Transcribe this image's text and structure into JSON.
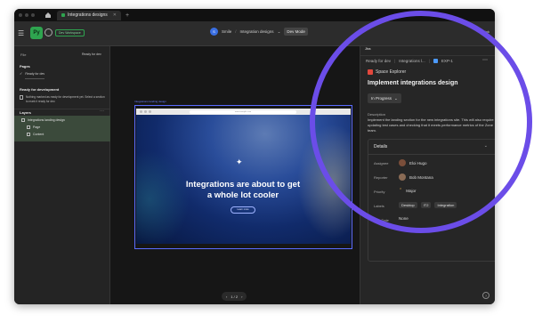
{
  "tabbar": {
    "tab_title": "Integrations designs"
  },
  "toolbar": {
    "mode_label": "Py",
    "badge": "Dev Workspace",
    "team": "Smile",
    "file": "Integration designs",
    "dev_mode": "Dev Mode",
    "right_label": "Link"
  },
  "left_panel": {
    "header_left": "File",
    "header_right": "Ready for dev",
    "pages_title": "Pages",
    "pages_item": "Ready for dev",
    "ready_title": "Ready for development",
    "ready_text": "Nothing marked as ready for development yet. Select a section to mark it ready for dev.",
    "layers_title": "Layers",
    "layers": [
      {
        "label": "Integrations landing design"
      },
      {
        "label": "Page"
      },
      {
        "label": "Content"
      }
    ]
  },
  "canvas": {
    "frame_label": "Integrations landing design",
    "url_text": "www.example.com",
    "sparkle": "✦",
    "hero_line1": "Integrations are about to get",
    "hero_line2": "a whole lot cooler",
    "hero_button": "Learn more",
    "pager": "1 / 2"
  },
  "right_panel": {
    "tab": "Jira",
    "crumb_status": "Ready for dev",
    "crumb_file": "Integrations l...",
    "crumb_key": "EXP-1",
    "space": "Space Explorer",
    "issue_title": "Implement integrations design",
    "status": "In Progress",
    "desc_label": "Description",
    "description": "Implement the landing section for the new integrations site. This will also require updating test cases and checking that it meets performance metrics of the Zone team.",
    "details_title": "Details",
    "fields": {
      "assignee_label": "Assignee",
      "assignee": "Eloi Hugo",
      "reporter_label": "Reporter",
      "reporter": "Bob Montana",
      "priority_label": "Priority",
      "priority": "Major",
      "labels_label": "Labels",
      "labels": [
        "Desktop",
        "IT2",
        "Integration"
      ],
      "due_label": "Due Date",
      "due": "None"
    }
  },
  "colors": {
    "accent_green": "#2ea44f",
    "highlight_ring": "#6b4de8",
    "frame_blue": "#5b6cff"
  }
}
